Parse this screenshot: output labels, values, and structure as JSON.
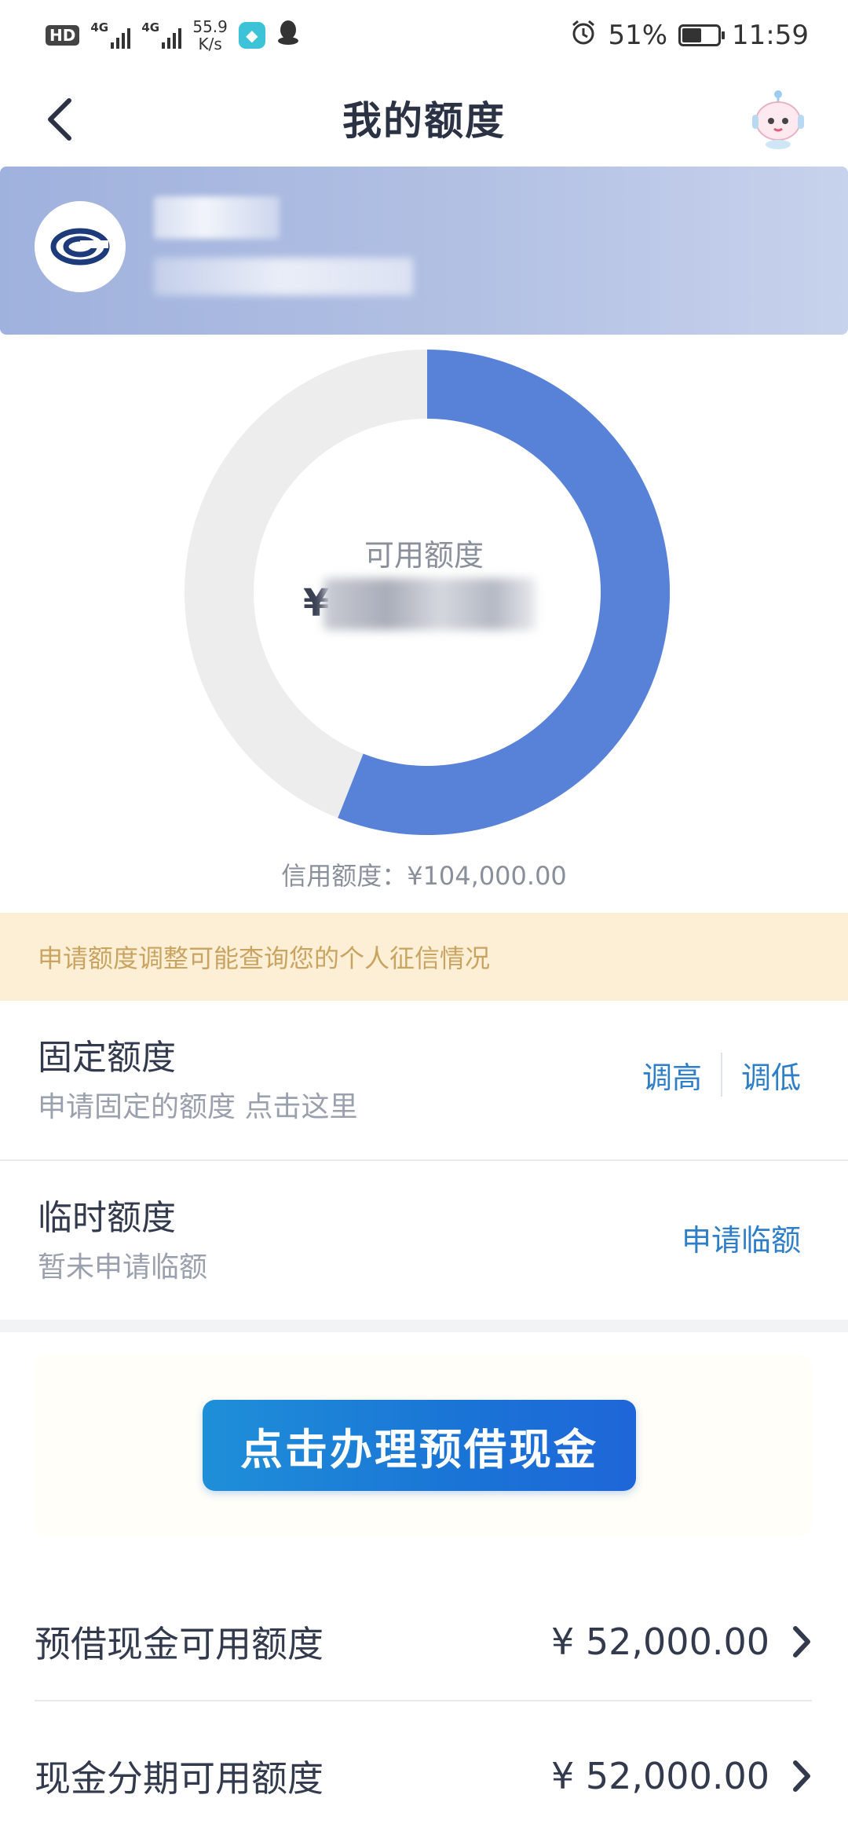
{
  "status_bar": {
    "hd": "HD",
    "net1": "4G",
    "net2": "4G",
    "speed_value": "55.9",
    "speed_unit": "K/s",
    "battery": "51%",
    "time": "11:59"
  },
  "header": {
    "title": "我的额度"
  },
  "donut": {
    "available_label": "可用额度",
    "currency_symbol": "¥",
    "available_fraction": 0.56,
    "credit_limit_text": "信用额度：¥104,000.00",
    "colors": {
      "available": "#5881d8",
      "used": "#ededed"
    }
  },
  "notice": {
    "text": "申请额度调整可能查询您的个人征信情况"
  },
  "fixed_limit": {
    "title": "固定额度",
    "subtitle": "申请固定的额度 点击这里",
    "increase": "调高",
    "decrease": "调低"
  },
  "temp_limit": {
    "title": "临时额度",
    "subtitle": "暂未申请临额",
    "apply": "申请临额"
  },
  "cta": {
    "label": "点击办理预借现金"
  },
  "lists": [
    {
      "label": "预借现金可用额度",
      "value": "¥ 52,000.00"
    },
    {
      "label": "现金分期可用额度",
      "value": "¥ 52,000.00"
    }
  ]
}
